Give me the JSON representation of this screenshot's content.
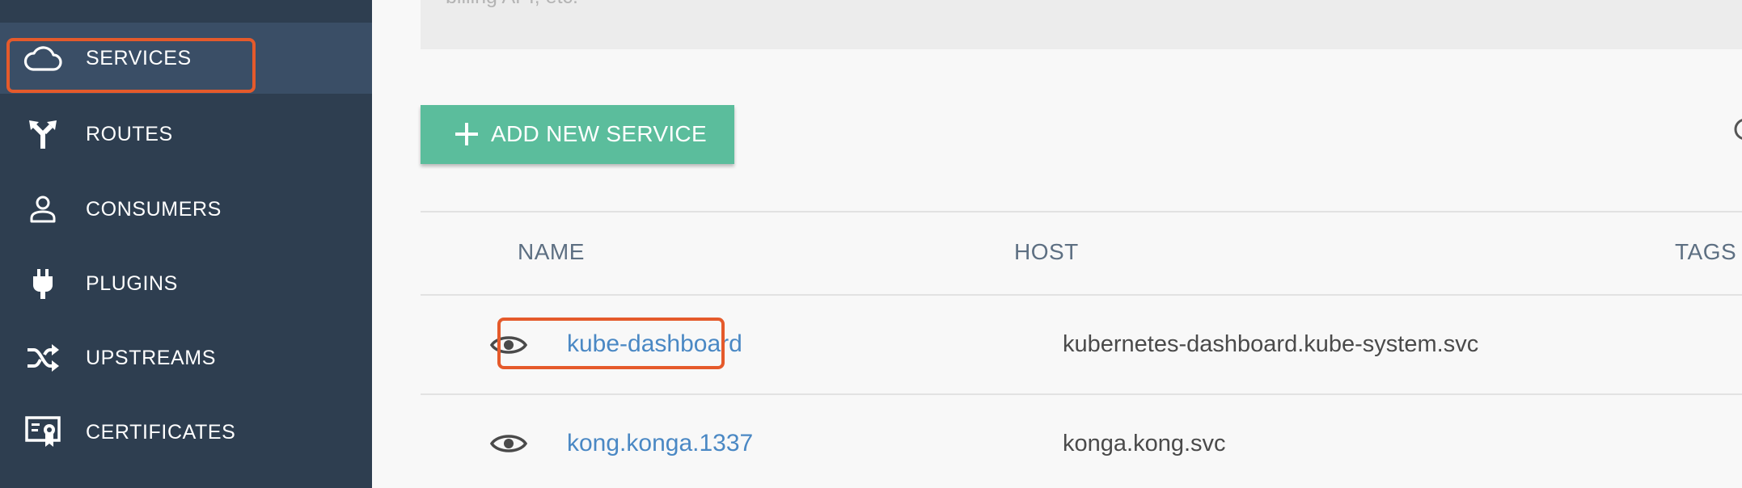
{
  "sidebar": {
    "items": [
      {
        "label": "SERVICES",
        "icon": "cloud-icon",
        "active": true
      },
      {
        "label": "ROUTES",
        "icon": "route-icon",
        "active": false
      },
      {
        "label": "CONSUMERS",
        "icon": "user-icon",
        "active": false
      },
      {
        "label": "PLUGINS",
        "icon": "plug-icon",
        "active": false
      },
      {
        "label": "UPSTREAMS",
        "icon": "shuffle-icon",
        "active": false
      },
      {
        "label": "CERTIFICATES",
        "icon": "certificate-icon",
        "active": false
      }
    ]
  },
  "main": {
    "description_partial": "billing API, etc.",
    "add_button_label": "ADD NEW SERVICE",
    "table": {
      "columns": [
        "NAME",
        "HOST",
        "TAGS"
      ],
      "rows": [
        {
          "name": "kube-dashboard",
          "host": "kubernetes-dashboard.kube-system.svc"
        },
        {
          "name": "kong.konga.1337",
          "host": "konga.kong.svc"
        }
      ]
    }
  },
  "colors": {
    "sidebar_bg": "#2e3e50",
    "sidebar_active": "#3a4e66",
    "accent_green": "#5bbd9c",
    "link_blue": "#4a88c4",
    "highlight_orange": "#e55a2b"
  }
}
